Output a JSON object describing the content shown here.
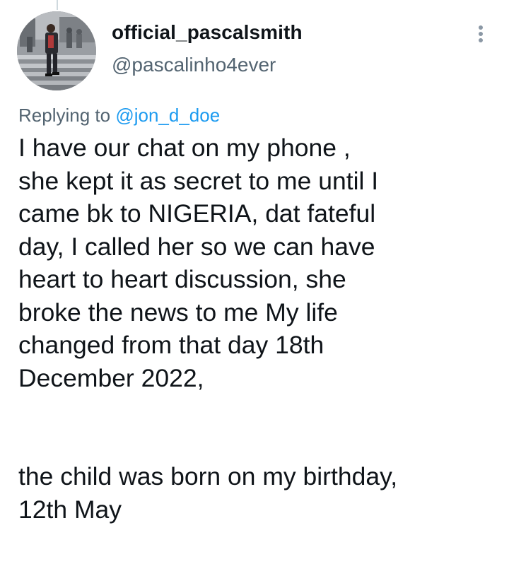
{
  "author": {
    "display_name": "official_pascalsmith",
    "handle": "@pascalinho4ever"
  },
  "reply_context": {
    "prefix": "Replying to ",
    "mention": "@jon_d_doe"
  },
  "tweet": {
    "paragraph_1": "I have our chat on my phone ,\nshe kept it as secret to me until I\ncame bk to NIGERIA, dat fateful\nday, I called her so we can have\nheart to heart discussion, she\nbroke the news to me My life\nchanged from that day 18th\nDecember 2022,",
    "paragraph_2": "the child was born on my birthday,\n12th May"
  },
  "icons": {
    "more": "more-vertical-icon",
    "avatar": "profile-photo"
  },
  "colors": {
    "text_primary": "#0f1419",
    "text_secondary": "#536471",
    "link": "#1d9bf0",
    "icon": "#8b98a5"
  }
}
